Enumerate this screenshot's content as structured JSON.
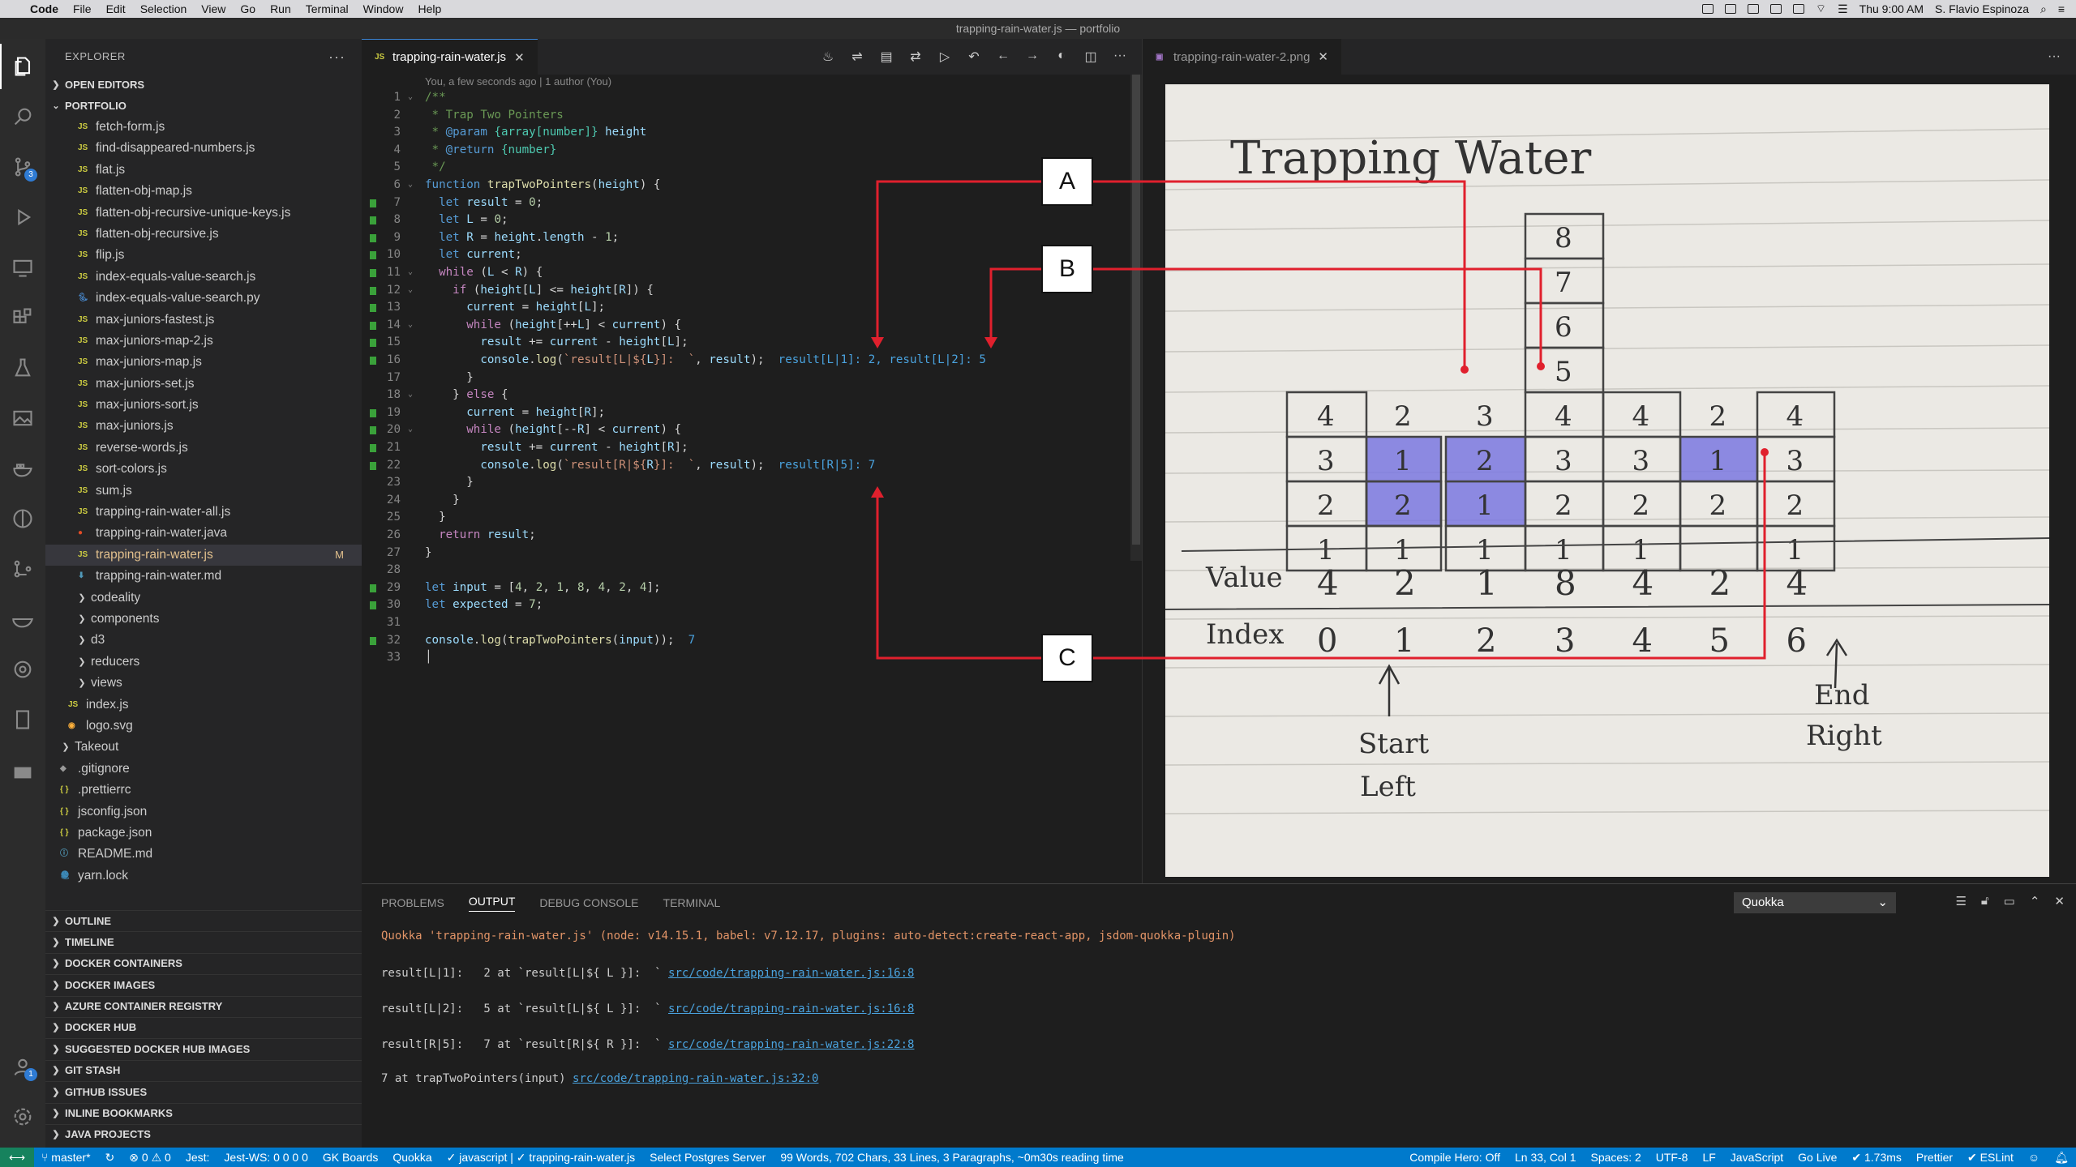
{
  "menubar": {
    "app": "Code",
    "items": [
      "File",
      "Edit",
      "Selection",
      "View",
      "Go",
      "Run",
      "Terminal",
      "Window",
      "Help"
    ],
    "clock": "Thu 9:00 AM",
    "user": "S. Flavio Espinoza"
  },
  "window_title": "trapping-rain-water.js — portfolio",
  "explorer": {
    "title": "EXPLORER",
    "open_editors": "OPEN EDITORS",
    "root": "PORTFOLIO",
    "files": [
      {
        "name": "fetch-form.js",
        "icon": "js"
      },
      {
        "name": "find-disappeared-numbers.js",
        "icon": "js"
      },
      {
        "name": "flat.js",
        "icon": "js"
      },
      {
        "name": "flatten-obj-map.js",
        "icon": "js"
      },
      {
        "name": "flatten-obj-recursive-unique-keys.js",
        "icon": "js"
      },
      {
        "name": "flatten-obj-recursive.js",
        "icon": "js"
      },
      {
        "name": "flip.js",
        "icon": "js"
      },
      {
        "name": "index-equals-value-search.js",
        "icon": "js"
      },
      {
        "name": "index-equals-value-search.py",
        "icon": "py"
      },
      {
        "name": "max-juniors-fastest.js",
        "icon": "js"
      },
      {
        "name": "max-juniors-map-2.js",
        "icon": "js"
      },
      {
        "name": "max-juniors-map.js",
        "icon": "js"
      },
      {
        "name": "max-juniors-set.js",
        "icon": "js"
      },
      {
        "name": "max-juniors-sort.js",
        "icon": "js"
      },
      {
        "name": "max-juniors.js",
        "icon": "js"
      },
      {
        "name": "reverse-words.js",
        "icon": "js"
      },
      {
        "name": "sort-colors.js",
        "icon": "js"
      },
      {
        "name": "sum.js",
        "icon": "js"
      },
      {
        "name": "trapping-rain-water-all.js",
        "icon": "js"
      },
      {
        "name": "trapping-rain-water.java",
        "icon": "java"
      },
      {
        "name": "trapping-rain-water.js",
        "icon": "js",
        "selected": true,
        "badge": "M"
      },
      {
        "name": "trapping-rain-water.md",
        "icon": "md"
      }
    ],
    "folders": [
      "codeality",
      "components",
      "d3",
      "reducers",
      "views"
    ],
    "sub_files": [
      {
        "name": "index.js",
        "icon": "js"
      },
      {
        "name": "logo.svg",
        "icon": "svg"
      }
    ],
    "takeout": "Takeout",
    "root_files": [
      {
        "name": ".gitignore",
        "icon": "git"
      },
      {
        "name": ".prettierrc",
        "icon": "json"
      },
      {
        "name": "jsconfig.json",
        "icon": "json"
      },
      {
        "name": "package.json",
        "icon": "json"
      },
      {
        "name": "README.md",
        "icon": "info"
      },
      {
        "name": "yarn.lock",
        "icon": "yarn"
      }
    ],
    "sections": [
      "OUTLINE",
      "TIMELINE",
      "DOCKER CONTAINERS",
      "DOCKER IMAGES",
      "AZURE CONTAINER REGISTRY",
      "DOCKER HUB",
      "SUGGESTED DOCKER HUB IMAGES",
      "GIT STASH",
      "GITHUB ISSUES",
      "INLINE BOOKMARKS",
      "JAVA PROJECTS"
    ]
  },
  "editor": {
    "tab": "trapping-rain-water.js",
    "blame": "You, a few seconds ago | 1 author (You)",
    "image_tab": "trapping-rain-water-2.png"
  },
  "panel": {
    "tabs": [
      "PROBLEMS",
      "OUTPUT",
      "DEBUG CONSOLE",
      "TERMINAL"
    ],
    "active_tab": "OUTPUT",
    "selector": "Quokka",
    "lines": [
      {
        "text": "Quokka 'trapping-rain-water.js' (node: v14.15.1, babel: v7.12.17, plugins: auto-detect:create-react-app, jsdom-quokka-plugin)",
        "link": ""
      },
      {
        "text": "result[L|1]:   2 at `result[L|${ L }]:  ` ",
        "link": "src/code/trapping-rain-water.js:16:8"
      },
      {
        "text": "result[L|2]:   5 at `result[L|${ L }]:  ` ",
        "link": "src/code/trapping-rain-water.js:16:8"
      },
      {
        "text": "result[R|5]:   7 at `result[R|${ R }]:  ` ",
        "link": "src/code/trapping-rain-water.js:22:8"
      },
      {
        "text": "7 at trapTwoPointers(input) ",
        "link": "src/code/trapping-rain-water.js:32:0"
      }
    ]
  },
  "statusbar": {
    "branch": "master*",
    "errors": "0",
    "warnings": "0",
    "items_left": [
      "Jest:",
      "Jest-WS: 0 0 0 0",
      "GK Boards",
      "Quokka",
      "✓ javascript | ✓ trapping-rain-water.js",
      "Select Postgres Server",
      "99 Words, 702 Chars, 33 Lines, 3 Paragraphs, ~0m30s reading time"
    ],
    "items_right": [
      "Compile Hero: Off",
      "Ln 33, Col 1",
      "Spaces: 2",
      "UTF-8",
      "LF",
      "JavaScript",
      "Go Live",
      "✔ 1.73ms",
      "Prettier",
      "✔ ESLint"
    ]
  },
  "callouts": {
    "a": "A",
    "b": "B",
    "c": "C"
  },
  "drawing": {
    "title": "Trapping Water",
    "value_label": "Value",
    "index_label": "Index",
    "values": [
      "4",
      "2",
      "1",
      "8",
      "4",
      "2",
      "4"
    ],
    "indices": [
      "0",
      "1",
      "2",
      "3",
      "4",
      "5",
      "6"
    ],
    "start_label_1": "Start",
    "start_label_2": "Left",
    "end_label_1": "End",
    "end_label_2": "Right",
    "bar_numbers": {
      "col0": [
        "4",
        "3",
        "2",
        "1"
      ],
      "col1": [
        "2",
        "1",
        "2",
        "1"
      ],
      "col2": [
        "3",
        "2",
        "1",
        "1"
      ],
      "col3": [
        "8",
        "7",
        "6",
        "5",
        "4",
        "3",
        "2",
        "1"
      ],
      "col4": [
        "4",
        "3",
        "2",
        "1"
      ],
      "col5": [
        "2",
        "1",
        "2"
      ],
      "col6": [
        "4",
        "3",
        "2",
        "1"
      ]
    },
    "water_color": "#7b78e0"
  },
  "colors": {
    "accent": "#007acc",
    "annotation": "#e0202d",
    "git_added": "#3aa13a"
  }
}
